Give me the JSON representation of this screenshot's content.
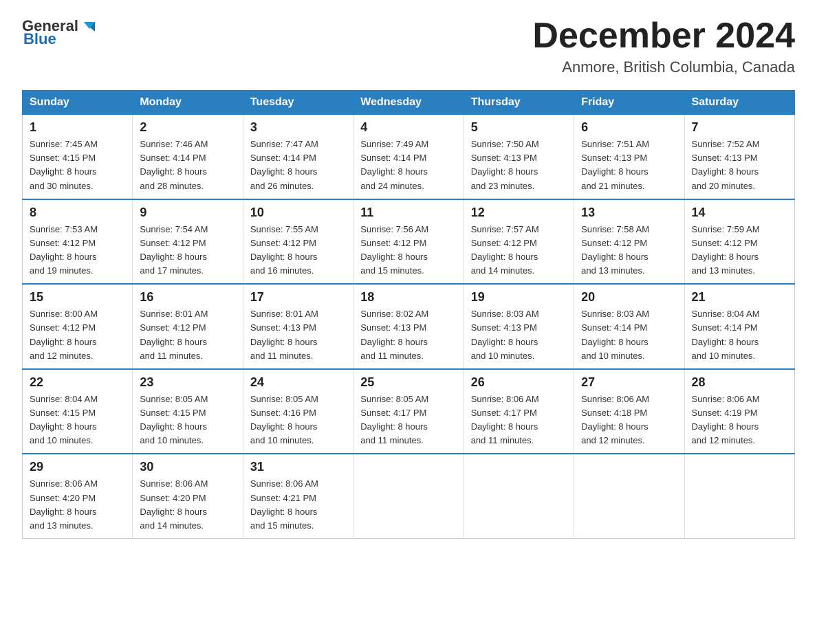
{
  "logo": {
    "general": "General",
    "blue": "Blue"
  },
  "header": {
    "month": "December 2024",
    "location": "Anmore, British Columbia, Canada"
  },
  "days_of_week": [
    "Sunday",
    "Monday",
    "Tuesday",
    "Wednesday",
    "Thursday",
    "Friday",
    "Saturday"
  ],
  "weeks": [
    [
      {
        "day": "1",
        "sunrise": "7:45 AM",
        "sunset": "4:15 PM",
        "daylight": "8 hours and 30 minutes."
      },
      {
        "day": "2",
        "sunrise": "7:46 AM",
        "sunset": "4:14 PM",
        "daylight": "8 hours and 28 minutes."
      },
      {
        "day": "3",
        "sunrise": "7:47 AM",
        "sunset": "4:14 PM",
        "daylight": "8 hours and 26 minutes."
      },
      {
        "day": "4",
        "sunrise": "7:49 AM",
        "sunset": "4:14 PM",
        "daylight": "8 hours and 24 minutes."
      },
      {
        "day": "5",
        "sunrise": "7:50 AM",
        "sunset": "4:13 PM",
        "daylight": "8 hours and 23 minutes."
      },
      {
        "day": "6",
        "sunrise": "7:51 AM",
        "sunset": "4:13 PM",
        "daylight": "8 hours and 21 minutes."
      },
      {
        "day": "7",
        "sunrise": "7:52 AM",
        "sunset": "4:13 PM",
        "daylight": "8 hours and 20 minutes."
      }
    ],
    [
      {
        "day": "8",
        "sunrise": "7:53 AM",
        "sunset": "4:12 PM",
        "daylight": "8 hours and 19 minutes."
      },
      {
        "day": "9",
        "sunrise": "7:54 AM",
        "sunset": "4:12 PM",
        "daylight": "8 hours and 17 minutes."
      },
      {
        "day": "10",
        "sunrise": "7:55 AM",
        "sunset": "4:12 PM",
        "daylight": "8 hours and 16 minutes."
      },
      {
        "day": "11",
        "sunrise": "7:56 AM",
        "sunset": "4:12 PM",
        "daylight": "8 hours and 15 minutes."
      },
      {
        "day": "12",
        "sunrise": "7:57 AM",
        "sunset": "4:12 PM",
        "daylight": "8 hours and 14 minutes."
      },
      {
        "day": "13",
        "sunrise": "7:58 AM",
        "sunset": "4:12 PM",
        "daylight": "8 hours and 13 minutes."
      },
      {
        "day": "14",
        "sunrise": "7:59 AM",
        "sunset": "4:12 PM",
        "daylight": "8 hours and 13 minutes."
      }
    ],
    [
      {
        "day": "15",
        "sunrise": "8:00 AM",
        "sunset": "4:12 PM",
        "daylight": "8 hours and 12 minutes."
      },
      {
        "day": "16",
        "sunrise": "8:01 AM",
        "sunset": "4:12 PM",
        "daylight": "8 hours and 11 minutes."
      },
      {
        "day": "17",
        "sunrise": "8:01 AM",
        "sunset": "4:13 PM",
        "daylight": "8 hours and 11 minutes."
      },
      {
        "day": "18",
        "sunrise": "8:02 AM",
        "sunset": "4:13 PM",
        "daylight": "8 hours and 11 minutes."
      },
      {
        "day": "19",
        "sunrise": "8:03 AM",
        "sunset": "4:13 PM",
        "daylight": "8 hours and 10 minutes."
      },
      {
        "day": "20",
        "sunrise": "8:03 AM",
        "sunset": "4:14 PM",
        "daylight": "8 hours and 10 minutes."
      },
      {
        "day": "21",
        "sunrise": "8:04 AM",
        "sunset": "4:14 PM",
        "daylight": "8 hours and 10 minutes."
      }
    ],
    [
      {
        "day": "22",
        "sunrise": "8:04 AM",
        "sunset": "4:15 PM",
        "daylight": "8 hours and 10 minutes."
      },
      {
        "day": "23",
        "sunrise": "8:05 AM",
        "sunset": "4:15 PM",
        "daylight": "8 hours and 10 minutes."
      },
      {
        "day": "24",
        "sunrise": "8:05 AM",
        "sunset": "4:16 PM",
        "daylight": "8 hours and 10 minutes."
      },
      {
        "day": "25",
        "sunrise": "8:05 AM",
        "sunset": "4:17 PM",
        "daylight": "8 hours and 11 minutes."
      },
      {
        "day": "26",
        "sunrise": "8:06 AM",
        "sunset": "4:17 PM",
        "daylight": "8 hours and 11 minutes."
      },
      {
        "day": "27",
        "sunrise": "8:06 AM",
        "sunset": "4:18 PM",
        "daylight": "8 hours and 12 minutes."
      },
      {
        "day": "28",
        "sunrise": "8:06 AM",
        "sunset": "4:19 PM",
        "daylight": "8 hours and 12 minutes."
      }
    ],
    [
      {
        "day": "29",
        "sunrise": "8:06 AM",
        "sunset": "4:20 PM",
        "daylight": "8 hours and 13 minutes."
      },
      {
        "day": "30",
        "sunrise": "8:06 AM",
        "sunset": "4:20 PM",
        "daylight": "8 hours and 14 minutes."
      },
      {
        "day": "31",
        "sunrise": "8:06 AM",
        "sunset": "4:21 PM",
        "daylight": "8 hours and 15 minutes."
      },
      null,
      null,
      null,
      null
    ]
  ],
  "labels": {
    "sunrise": "Sunrise: ",
    "sunset": "Sunset: ",
    "daylight": "Daylight: "
  }
}
